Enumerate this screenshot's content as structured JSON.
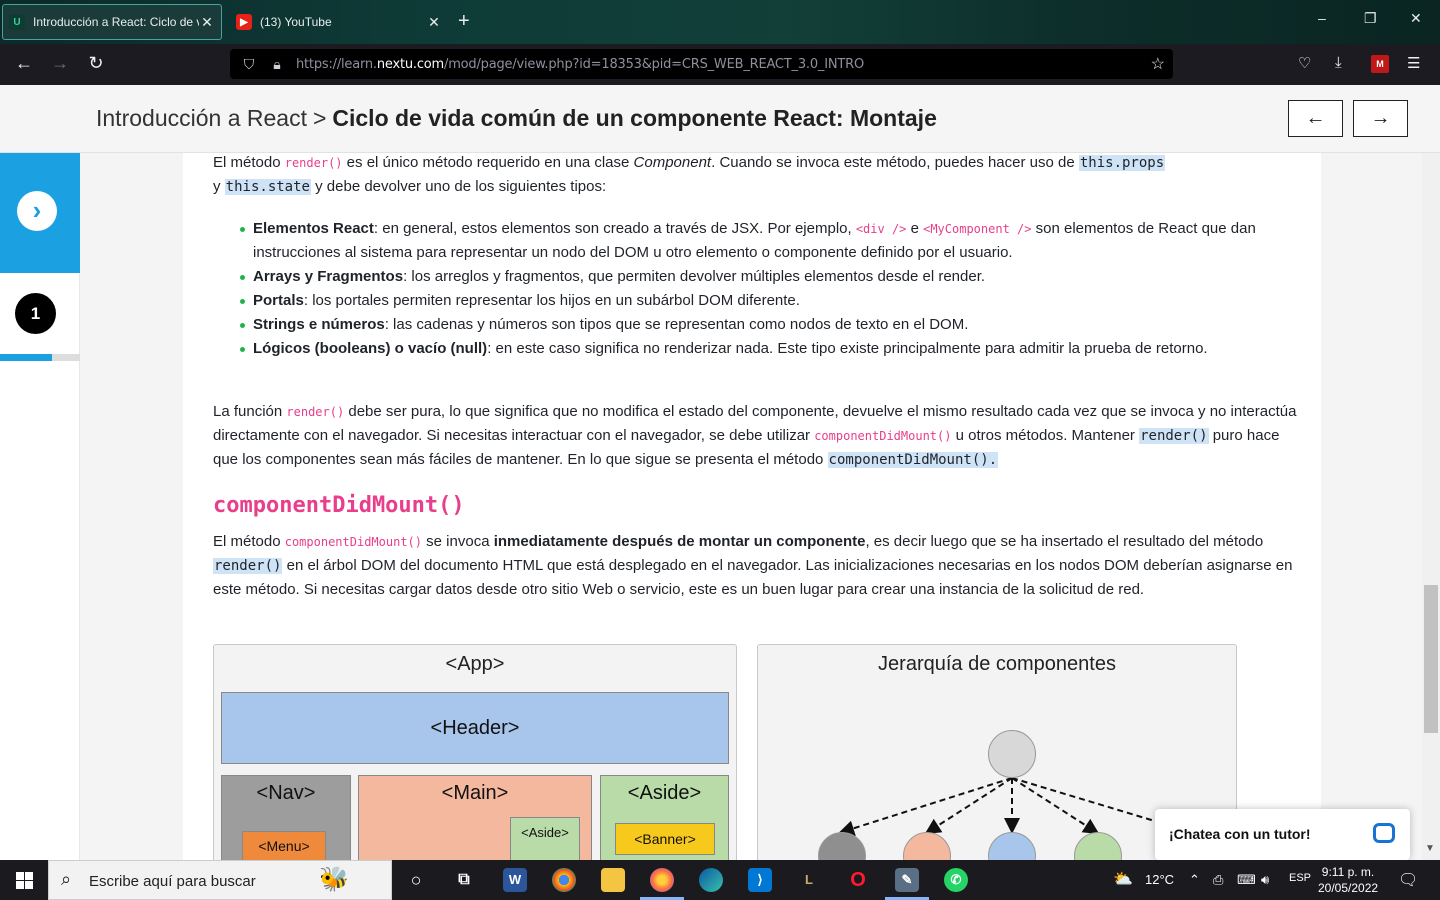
{
  "browser": {
    "tabs": [
      {
        "title": "Introducción a React: Ciclo de v",
        "favicon": "U",
        "active": true
      },
      {
        "title": "(13) YouTube",
        "favicon": "▶",
        "active": false
      }
    ],
    "url_prefix": "https://learn.",
    "url_domain": "nextu.com",
    "url_path": "/mod/page/view.php?id=18353&pid=CRS_WEB_REACT_3.0_INTRO",
    "window_controls": {
      "minimize": "–",
      "maximize": "❐",
      "close": "✕"
    }
  },
  "header": {
    "parent": "Introducción a React",
    "separator": ">",
    "current": "Ciclo de vida común de un componente React: Montaje",
    "prev_arrow": "←",
    "next_arrow": "→"
  },
  "sidebar": {
    "next_icon": "›",
    "step_number": "1",
    "progress_fraction": 0.65,
    "accent_color": "#1ba0e2"
  },
  "content": {
    "p1": {
      "a": "El método ",
      "code1": "render()",
      "b": " es el único método requerido en una clase ",
      "em": "Component",
      "c": ". Cuando se invoca este método, puedes hacer uso de ",
      "hl1": "this.props",
      "d": "y ",
      "hl2": "this.state",
      "e": " y debe devolver uno de los siguientes tipos:"
    },
    "list": [
      {
        "bold": "Elementos React",
        "pre": ": en general, estos elementos son creado a través de JSX. Por ejemplo, ",
        "code1": "<div />",
        "mid": " e ",
        "code2": "<MyComponent />",
        "post": " son elementos de React que dan instrucciones al sistema para representar un nodo del DOM u otro elemento o componente definido por el usuario."
      },
      {
        "bold": "Arrays y Fragmentos",
        "text": ": los arreglos y fragmentos, que permiten devolver múltiples elementos desde el render."
      },
      {
        "bold": "Portals",
        "text": ": los portales permiten representar los hijos en un subárbol DOM diferente."
      },
      {
        "bold": "Strings e números",
        "text": ": las cadenas y números son tipos que se representan como nodos de texto en el DOM."
      },
      {
        "bold": "Lógicos (booleans) o vacío (null)",
        "text": ": en este caso significa no renderizar nada. Este tipo existe principalmente para admitir la prueba de retorno."
      }
    ],
    "p2": {
      "a": "La función ",
      "code1": "render()",
      "b": " debe ser pura, lo que significa que no modifica el estado del componente, devuelve el mismo resultado cada vez que se invoca y no interactúa directamente con el navegador. Si necesitas interactuar con el navegador, se debe utilizar ",
      "code2": "componentDidMount()",
      "c": " u otros métodos. Mantener ",
      "hl1": "render()",
      "d": " puro hace que los componentes sean más fáciles de mantener. En lo que sigue se presenta el método ",
      "hl2": "componentDidMount()."
    },
    "heading": "componentDidMount()",
    "p3": {
      "a": "El método ",
      "code1": "componentDidMount()",
      "b": " se invoca ",
      "bold": "inmediatamente después de montar un componente",
      "c": ", es decir luego que se ha insertado el resultado del método ",
      "hl1": "render()",
      "d": " en el árbol DOM del documento HTML que está desplegado en el navegador. Las inicializaciones necesarias en los nodos DOM deberían asignarse en este método. Si necesitas cargar datos desde otro sitio Web o servicio, este es un buen lugar para crear una instancia de la solicitud de red."
    },
    "figure_left": {
      "title": "<App>",
      "header": "<Header>",
      "nav": "<Nav>",
      "menu": "<Menu>",
      "main": "<Main>",
      "main_aside": "<Aside>",
      "aside": "<Aside>",
      "banner": "<Banner>"
    },
    "figure_right": {
      "title": "Jerarquía de componentes"
    }
  },
  "chat": {
    "label": "¡Chatea con un tutor!"
  },
  "taskbar": {
    "search_placeholder": "Escribe aquí para buscar",
    "weather": "12°C",
    "lang": "ESP",
    "time": "9:11 p. m.",
    "date": "20/05/2022"
  }
}
